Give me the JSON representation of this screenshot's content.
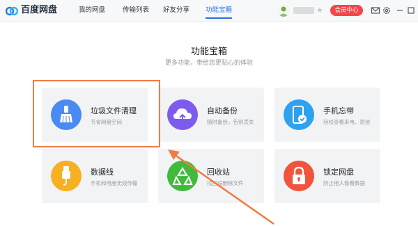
{
  "app": {
    "name": "百度网盘"
  },
  "nav": [
    "我的网盘",
    "传输列表",
    "好友分享",
    "功能宝箱"
  ],
  "nav_active_index": 3,
  "header": {
    "member_label": "会员中心"
  },
  "page": {
    "title": "功能宝箱",
    "subtitle": "更多功能，带给您更贴心的体验"
  },
  "tools": [
    {
      "title": "垃圾文件清理",
      "desc": "节省网盘空间",
      "icon": "broom-icon",
      "color": "#4a8af4"
    },
    {
      "title": "自动备份",
      "desc": "随时备份，告别丢失",
      "icon": "cloud-upload-icon",
      "color": "#7e5bef"
    },
    {
      "title": "手机忘带",
      "desc": "轻松查看来电、短信",
      "icon": "phone-check-icon",
      "color": "#2ea1ef"
    },
    {
      "title": "数据线",
      "desc": "手机和电脑无线传输",
      "icon": "usb-cable-icon",
      "color": "#f7b022"
    },
    {
      "title": "回收站",
      "desc": "找回误删除文件",
      "icon": "recycle-icon",
      "color": "#3fba3b"
    },
    {
      "title": "锁定网盘",
      "desc": "防止他人偷看数据",
      "icon": "lock-icon",
      "color": "#f1533d"
    }
  ],
  "colors": {
    "accent": "#2a6fe6",
    "member": "#f2464b",
    "highlight": "#f07c45"
  }
}
